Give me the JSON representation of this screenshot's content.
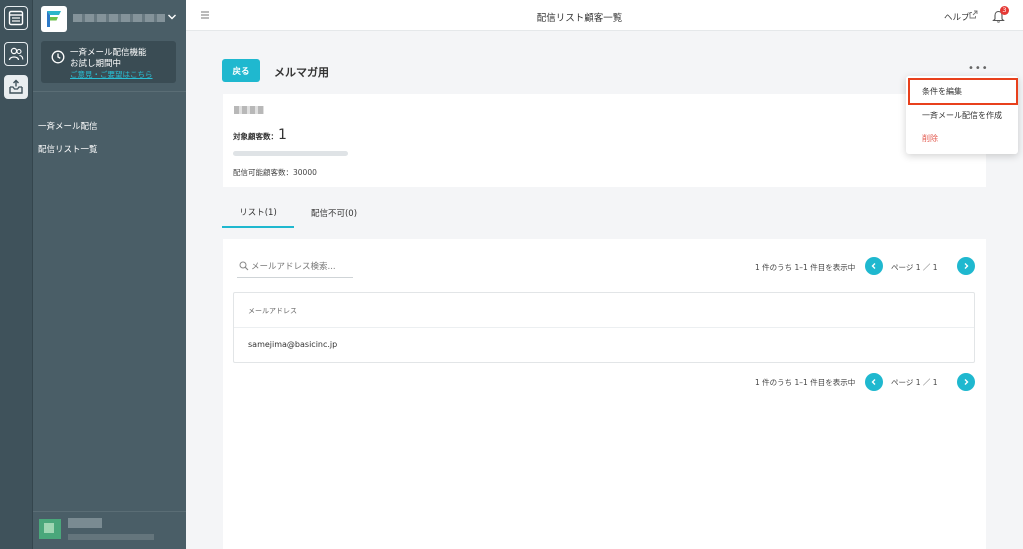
{
  "topbar": {
    "title": "配信リスト顧客一覧",
    "help_label": "ヘルプ",
    "notification_count": "3"
  },
  "sidebar": {
    "trial": {
      "line1": "一斉メール配信機能",
      "line2": "お試し期間中",
      "link": "ご意見・ご要望はこちら"
    },
    "items": [
      {
        "label": "一斉メール配信"
      },
      {
        "label": "配信リスト一覧"
      }
    ]
  },
  "header": {
    "back_label": "戻る",
    "list_name": "メルマガ用",
    "more_label": "•••"
  },
  "info": {
    "count_label": "対象顧客数：",
    "count_value": "1",
    "sendable_label": "配信可能顧客数：30000"
  },
  "tabs": [
    {
      "label": "リスト(1)",
      "active": true
    },
    {
      "label": "配信不可(0)",
      "active": false
    }
  ],
  "list": {
    "search_placeholder": "メールアドレス検索...",
    "pager_summary": "1 件のうち 1–1 件目を表示中",
    "page_label": "ページ 1 ／ 1",
    "column_header": "メールアドレス",
    "rows": [
      {
        "email": "samejima@basicinc.jp"
      }
    ]
  },
  "dropdown": {
    "items": [
      {
        "label": "条件を編集"
      },
      {
        "label": "一斉メール配信を作成"
      },
      {
        "label": "削除",
        "danger": true
      }
    ],
    "highlight_color": "#e8401c"
  },
  "colors": {
    "accent": "#1fb8cf",
    "sidebar": "#4a5e67",
    "rail": "#3f525b",
    "danger": "#e35a4f"
  },
  "icons": {
    "rail": [
      "browser-window-icon",
      "users-icon",
      "outbox-icon"
    ],
    "topbar": [
      "hamburger-icon",
      "external-link-icon",
      "bell-icon"
    ]
  }
}
